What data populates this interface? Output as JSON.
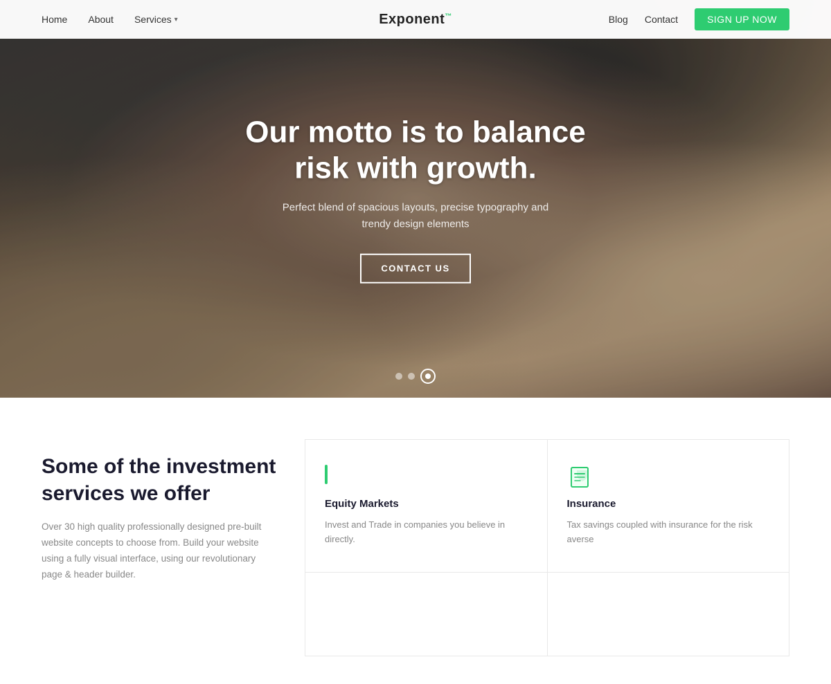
{
  "nav": {
    "logo": "Exponent",
    "logo_sup": "™",
    "links_left": [
      {
        "label": "Home",
        "active": false
      },
      {
        "label": "About",
        "active": false
      },
      {
        "label": "Services",
        "active": false,
        "has_dropdown": true
      }
    ],
    "links_right": [
      {
        "label": "Blog"
      },
      {
        "label": "Contact"
      }
    ],
    "cta": "SIGN UP NOW"
  },
  "hero": {
    "title_line1": "Our motto is to balance",
    "title_line2": "risk with growth.",
    "subtitle": "Perfect blend of spacious layouts, precise typography and\ntrendy design elements",
    "cta_button": "CONTACT US",
    "dots": [
      {
        "active": false
      },
      {
        "active": false
      },
      {
        "active": true
      }
    ]
  },
  "services": {
    "heading_line1": "Some of the investment",
    "heading_line2": "services we offer",
    "description": "Over 30 high quality professionally designed pre-built website concepts to choose from. Build your website using a fully visual interface, using our revolutionary page & header builder.",
    "cards": [
      {
        "id": "equity",
        "icon_type": "bar",
        "title": "Equity Markets",
        "description": "Invest and Trade in companies you believe in directly."
      },
      {
        "id": "insurance",
        "icon_type": "document",
        "title": "Insurance",
        "description": "Tax savings coupled with insurance for the risk averse"
      },
      {
        "id": "empty1",
        "icon_type": "none",
        "title": "",
        "description": ""
      },
      {
        "id": "empty2",
        "icon_type": "none",
        "title": "",
        "description": ""
      }
    ]
  }
}
